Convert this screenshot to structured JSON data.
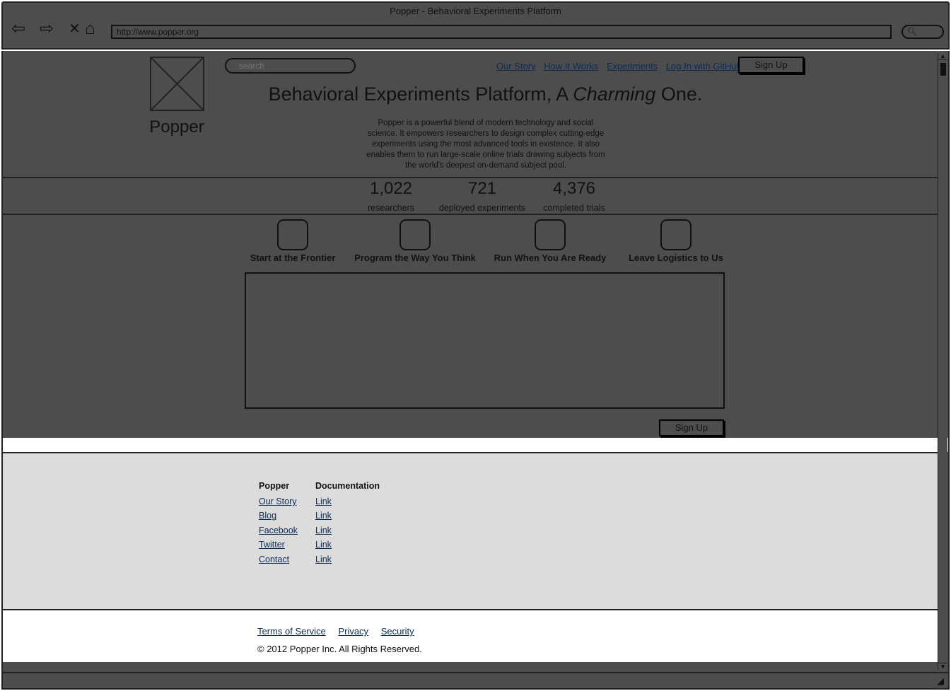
{
  "window": {
    "title": "Popper - Behavioral Experiments Platform",
    "url": "http://www.popper.org"
  },
  "header": {
    "logo_text": "Popper",
    "search_placeholder": "search",
    "nav": [
      "Our Story",
      "How It Works",
      "Experiments",
      "Log In with GitHub"
    ],
    "signup_label": "Sign Up"
  },
  "hero": {
    "headline_before": "Behavioral Experiments Platform, A ",
    "headline_emphasis": "Charming",
    "headline_after": " One.",
    "description": "Popper is a powerful blend of modern technology and social science. It empowers researchers to design complex cutting-edge experiments using the most advanced tools in existence. It also enables them to run large-scale online trials drawing subjects from the world's deepest on-demand subject pool."
  },
  "stats": [
    {
      "value": "1,022",
      "label": "researchers"
    },
    {
      "value": "721",
      "label": "deployed experiments"
    },
    {
      "value": "4,376",
      "label": "completed trials"
    }
  ],
  "features": [
    "Start at the Frontier",
    "Program the Way You Think",
    "Run When You Are Ready",
    "Leave Logistics to Us"
  ],
  "main": {
    "signup_label": "Sign Up"
  },
  "footer": {
    "columns": [
      {
        "heading": "Popper",
        "links": [
          "Our Story",
          "Blog",
          "Facebook",
          "Twitter",
          "Contact"
        ]
      },
      {
        "heading": "Documentation",
        "links": [
          "Link",
          "Link",
          "Link",
          "Link",
          "Link"
        ]
      }
    ],
    "legal_links": [
      "Terms of Service",
      "Privacy",
      "Security"
    ],
    "copyright": "© 2012 Popper Inc. All Rights Reserved."
  },
  "icons": {
    "back": "back-arrow-icon",
    "forward": "forward-arrow-icon",
    "stop": "close-icon",
    "home": "home-icon",
    "search": "search-icon",
    "logo": "image-placeholder-icon"
  }
}
